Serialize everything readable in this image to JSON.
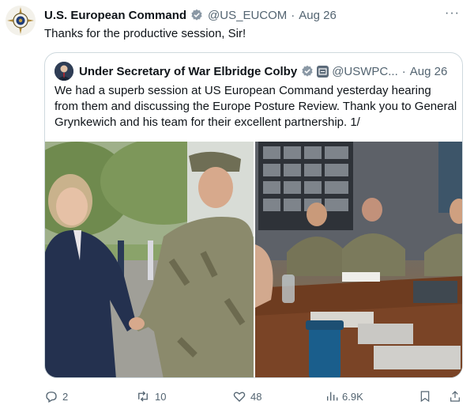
{
  "tweet": {
    "author_name": "U.S. European Command",
    "handle": "@US_EUCOM",
    "separator": "·",
    "date": "Aug 26",
    "text": "Thanks for the productive session, Sir!",
    "more_label": "···"
  },
  "quoted": {
    "author_name": "Under Secretary of War Elbridge Colby",
    "handle": "@USWPC...",
    "separator": "·",
    "date": "Aug 26",
    "text": "We had a superb session at US European Command yesterday hearing from them and discussing the Europe Posture Review. Thank you to General Grynkewich and his team for their excellent partnership. 1/"
  },
  "actions": {
    "replies": "2",
    "reposts": "10",
    "likes": "48",
    "views": "6.9K"
  },
  "icons": [
    "eucom-logo",
    "verified-badge",
    "government-badge",
    "reply-icon",
    "repost-icon",
    "like-icon",
    "views-icon",
    "bookmark-icon",
    "share-icon"
  ],
  "colors": {
    "verified": "#1d9bf0",
    "muted": "#536471",
    "border": "#cfd9de"
  }
}
